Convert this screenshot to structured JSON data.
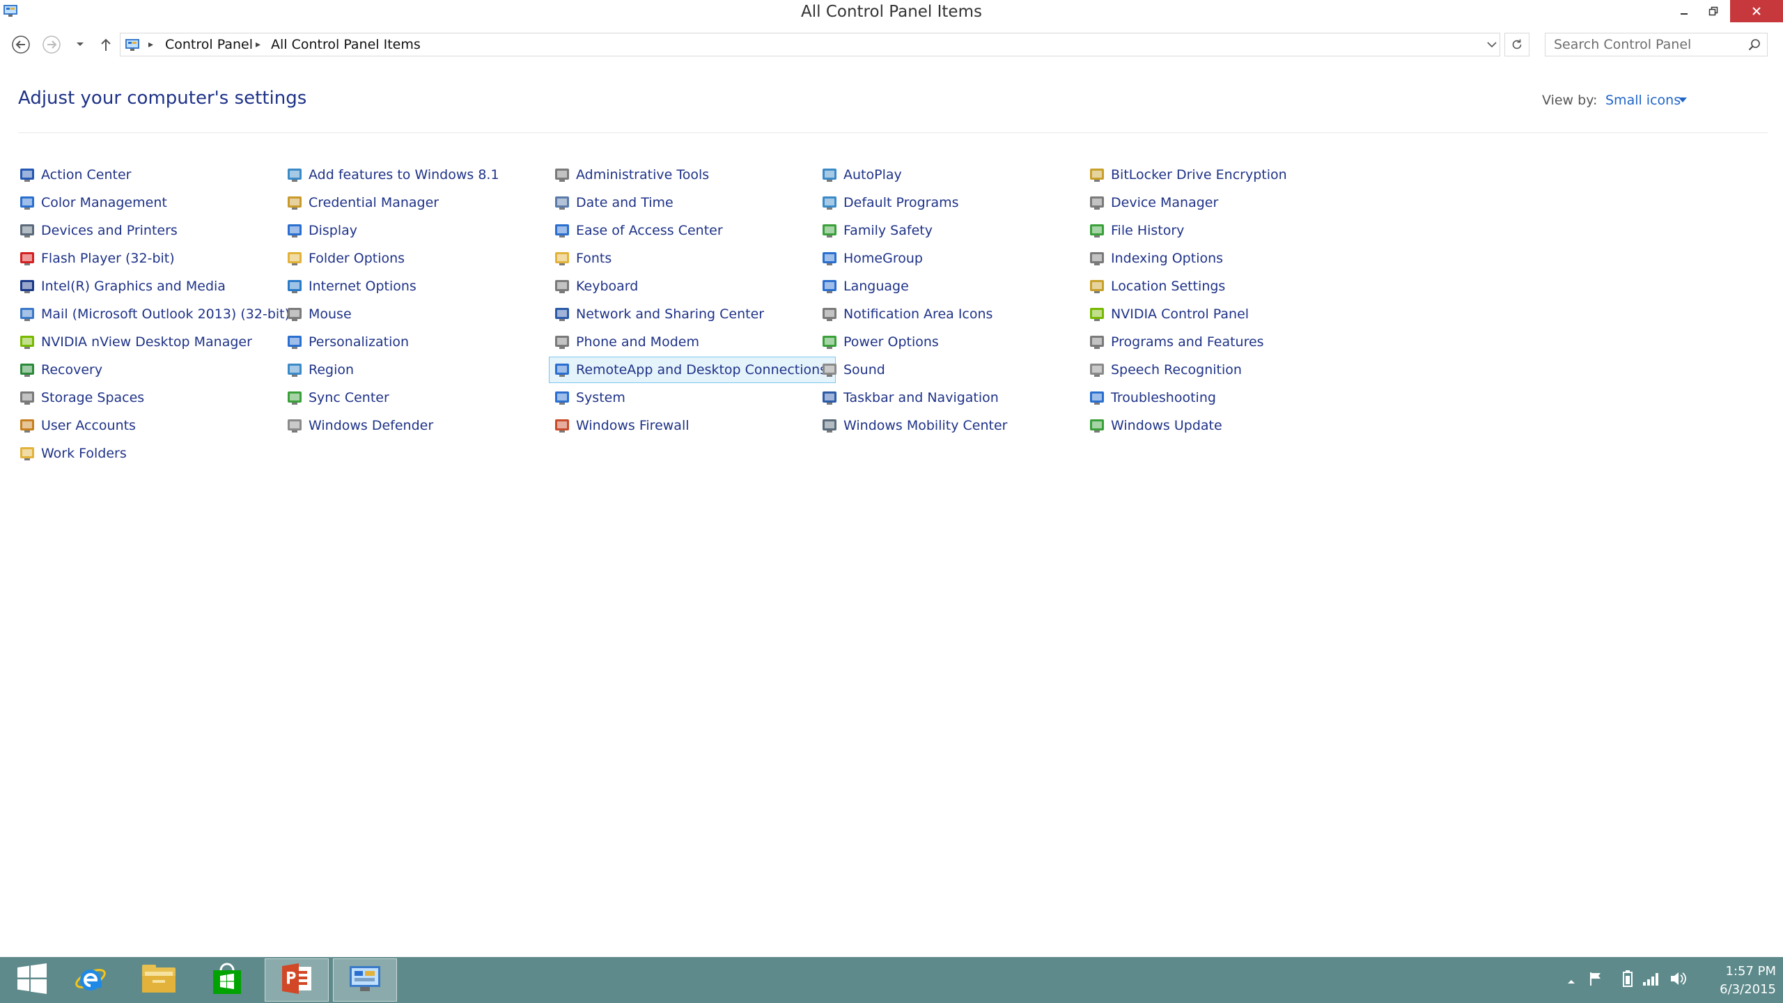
{
  "window": {
    "title": "All Control Panel Items"
  },
  "address_bar": {
    "breadcrumbs": [
      "Control Panel",
      "All Control Panel Items"
    ]
  },
  "search": {
    "placeholder": "Search Control Panel"
  },
  "header": {
    "title": "Adjust your computer's settings",
    "view_by_label": "View by:",
    "view_by_value": "Small icons"
  },
  "columns": [
    [
      {
        "label": "Action Center",
        "icon": "flag-icon",
        "color": "#2458b4"
      },
      {
        "label": "Color Management",
        "icon": "monitor-color-icon",
        "color": "#2a6fcf"
      },
      {
        "label": "Devices and Printers",
        "icon": "printer-icon",
        "color": "#5a6a7a"
      },
      {
        "label": "Flash Player (32-bit)",
        "icon": "flash-icon",
        "color": "#d42020"
      },
      {
        "label": "Intel(R) Graphics and Media",
        "icon": "intel-graphics-icon",
        "color": "#1a3a8a"
      },
      {
        "label": "Mail (Microsoft Outlook 2013) (32-bit)",
        "icon": "mail-icon",
        "color": "#3a78c8"
      },
      {
        "label": "NVIDIA nView Desktop Manager",
        "icon": "nvidia-nview-icon",
        "color": "#76b900"
      },
      {
        "label": "Recovery",
        "icon": "recovery-icon",
        "color": "#2a8a3a"
      },
      {
        "label": "Storage Spaces",
        "icon": "storage-icon",
        "color": "#7a7a7a"
      },
      {
        "label": "User Accounts",
        "icon": "users-icon",
        "color": "#c8801e"
      },
      {
        "label": "Work Folders",
        "icon": "work-folder-icon",
        "color": "#e2b23a"
      }
    ],
    [
      {
        "label": "Add features to Windows 8.1",
        "icon": "add-features-icon",
        "color": "#3a8ac8"
      },
      {
        "label": "Credential Manager",
        "icon": "credential-icon",
        "color": "#c89a2a"
      },
      {
        "label": "Display",
        "icon": "display-icon",
        "color": "#2a6fcf"
      },
      {
        "label": "Folder Options",
        "icon": "folder-options-icon",
        "color": "#e2b23a"
      },
      {
        "label": "Internet Options",
        "icon": "internet-options-icon",
        "color": "#2a7ac8"
      },
      {
        "label": "Mouse",
        "icon": "mouse-icon",
        "color": "#7a7a7a"
      },
      {
        "label": "Personalization",
        "icon": "personalization-icon",
        "color": "#2a6fcf"
      },
      {
        "label": "Region",
        "icon": "region-icon",
        "color": "#3a8ac8"
      },
      {
        "label": "Sync Center",
        "icon": "sync-icon",
        "color": "#3aa03a"
      },
      {
        "label": "Windows Defender",
        "icon": "defender-icon",
        "color": "#8a8a8a"
      }
    ],
    [
      {
        "label": "Administrative Tools",
        "icon": "admin-tools-icon",
        "color": "#7a7a7a"
      },
      {
        "label": "Date and Time",
        "icon": "clock-icon",
        "color": "#5a7aa8"
      },
      {
        "label": "Ease of Access Center",
        "icon": "ease-of-access-icon",
        "color": "#2a6fcf"
      },
      {
        "label": "Fonts",
        "icon": "fonts-icon",
        "color": "#e2b23a"
      },
      {
        "label": "Keyboard",
        "icon": "keyboard-icon",
        "color": "#7a7a7a"
      },
      {
        "label": "Network and Sharing Center",
        "icon": "network-icon",
        "color": "#2a5aa8"
      },
      {
        "label": "Phone and Modem",
        "icon": "phone-modem-icon",
        "color": "#7a7a7a"
      },
      {
        "label": "RemoteApp and Desktop Connections",
        "icon": "remoteapp-icon",
        "color": "#2a6fcf",
        "selected": true
      },
      {
        "label": "System",
        "icon": "system-icon",
        "color": "#2a6fcf"
      },
      {
        "label": "Windows Firewall",
        "icon": "firewall-icon",
        "color": "#c84a2a"
      }
    ],
    [
      {
        "label": "AutoPlay",
        "icon": "autoplay-icon",
        "color": "#3a8ac8"
      },
      {
        "label": "Default Programs",
        "icon": "default-programs-icon",
        "color": "#3a8ac8"
      },
      {
        "label": "Family Safety",
        "icon": "family-safety-icon",
        "color": "#3aa03a"
      },
      {
        "label": "HomeGroup",
        "icon": "homegroup-icon",
        "color": "#2a6fcf"
      },
      {
        "label": "Language",
        "icon": "language-icon",
        "color": "#2a6fcf"
      },
      {
        "label": "Notification Area Icons",
        "icon": "notification-icon",
        "color": "#7a7a7a"
      },
      {
        "label": "Power Options",
        "icon": "power-icon",
        "color": "#3aa03a"
      },
      {
        "label": "Sound",
        "icon": "speaker-icon",
        "color": "#8a8a8a"
      },
      {
        "label": "Taskbar and Navigation",
        "icon": "taskbar-icon",
        "color": "#2a5aa8"
      },
      {
        "label": "Windows Mobility Center",
        "icon": "mobility-icon",
        "color": "#5a6a7a"
      }
    ],
    [
      {
        "label": "BitLocker Drive Encryption",
        "icon": "bitlocker-icon",
        "color": "#c8a02a"
      },
      {
        "label": "Device Manager",
        "icon": "device-manager-icon",
        "color": "#7a7a7a"
      },
      {
        "label": "File History",
        "icon": "file-history-icon",
        "color": "#3aa03a"
      },
      {
        "label": "Indexing Options",
        "icon": "indexing-icon",
        "color": "#7a7a7a"
      },
      {
        "label": "Location Settings",
        "icon": "location-icon",
        "color": "#c8a02a"
      },
      {
        "label": "NVIDIA Control Panel",
        "icon": "nvidia-icon",
        "color": "#76b900"
      },
      {
        "label": "Programs and Features",
        "icon": "programs-icon",
        "color": "#7a7a7a"
      },
      {
        "label": "Speech Recognition",
        "icon": "microphone-icon",
        "color": "#8a8a8a"
      },
      {
        "label": "Troubleshooting",
        "icon": "troubleshooting-icon",
        "color": "#2a6fcf"
      },
      {
        "label": "Windows Update",
        "icon": "windows-update-icon",
        "color": "#3aa03a"
      }
    ]
  ],
  "taskbar": {
    "apps": [
      {
        "name": "start",
        "icon": "windows-logo-icon"
      },
      {
        "name": "internet-explorer",
        "icon": "internet-explorer-icon"
      },
      {
        "name": "file-explorer",
        "icon": "file-explorer-icon"
      },
      {
        "name": "store",
        "icon": "store-icon"
      },
      {
        "name": "powerpoint",
        "icon": "powerpoint-icon"
      },
      {
        "name": "control-panel",
        "icon": "control-panel-icon",
        "active": true
      }
    ],
    "clock_time": "1:57 PM",
    "clock_date": "6/3/2015"
  },
  "colors": {
    "link": "#1e3287",
    "accent": "#1e64c8",
    "taskbar": "#5e8a8b",
    "close_button": "#c7383c"
  }
}
